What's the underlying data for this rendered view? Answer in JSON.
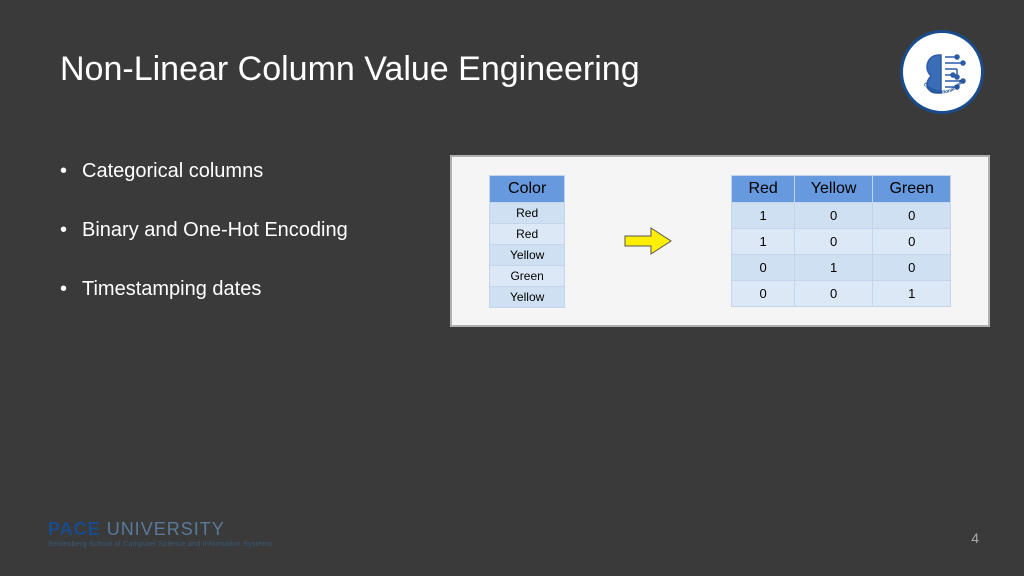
{
  "title": "Non-Linear Column Value Engineering",
  "bullets": [
    "Categorical columns",
    "Binary and One-Hot Encoding",
    "Timestamping dates"
  ],
  "logo": {
    "text": "Computational Intelligence Lab"
  },
  "table_left": {
    "header": "Color",
    "rows": [
      "Red",
      "Red",
      "Yellow",
      "Green",
      "Yellow"
    ]
  },
  "table_right": {
    "headers": [
      "Red",
      "Yellow",
      "Green"
    ],
    "rows": [
      [
        "1",
        "0",
        "0"
      ],
      [
        "1",
        "0",
        "0"
      ],
      [
        "0",
        "1",
        "0"
      ],
      [
        "0",
        "0",
        "1"
      ]
    ]
  },
  "footer": {
    "brand1": "PACE",
    "brand2": " UNIVERSITY",
    "tagline": "Seidenberg School of Computer Science and Information Systems"
  },
  "page_number": "4"
}
